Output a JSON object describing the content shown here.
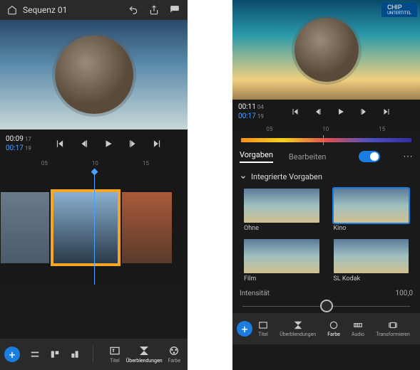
{
  "left": {
    "header": {
      "home_icon": "home-icon",
      "title": "Sequenz 01",
      "undo_icon": "undo-icon",
      "share_icon": "share-icon",
      "comment_icon": "comment-icon"
    },
    "transport": {
      "current": "00:09",
      "current_frames": "17",
      "duration": "00:17",
      "duration_frames": "19",
      "icons": [
        "skip-start-icon",
        "step-back-icon",
        "play-icon",
        "step-forward-icon",
        "skip-end-icon"
      ]
    },
    "ruler": {
      "marks": [
        "05",
        "10",
        "15"
      ]
    },
    "bottom": {
      "fab": "add-fab",
      "quick_icons": [
        "layout-a-icon",
        "layout-b-icon",
        "layout-c-icon"
      ],
      "tabs": [
        {
          "icon": "title-icon",
          "label": "Titel"
        },
        {
          "icon": "transitions-icon",
          "label": "Überblendungen"
        },
        {
          "icon": "color-icon",
          "label": "Farbe"
        }
      ]
    }
  },
  "right": {
    "chip": {
      "title": "CHIP",
      "subtitle": "UNTERTITEL"
    },
    "transport": {
      "current": "00:11",
      "current_frames": "04",
      "duration": "00:17",
      "duration_frames": "19",
      "icons": [
        "skip-start-icon",
        "step-back-icon",
        "play-icon",
        "step-forward-icon",
        "skip-end-icon"
      ]
    },
    "ruler": {
      "marks": [
        "05",
        "10",
        "15"
      ]
    },
    "tabs": {
      "presets": "Vorgaben",
      "edit": "Bearbeiten"
    },
    "section_title": "Integrierte Vorgaben",
    "presets": [
      {
        "label": "Ohne",
        "selected": false
      },
      {
        "label": "Kino",
        "selected": true
      },
      {
        "label": "Film",
        "selected": false
      },
      {
        "label": "SL Kodak",
        "selected": false
      }
    ],
    "intensity": {
      "label": "Intensität",
      "value": "100,0"
    },
    "bottom": {
      "fab": "add-fab",
      "tabs": [
        {
          "icon": "title-icon",
          "label": "Titel"
        },
        {
          "icon": "transitions-icon",
          "label": "Überblendungen"
        },
        {
          "icon": "color-icon",
          "label": "Farbe"
        },
        {
          "icon": "audio-icon",
          "label": "Audio"
        },
        {
          "icon": "transform-icon",
          "label": "Transformieren"
        }
      ]
    }
  }
}
